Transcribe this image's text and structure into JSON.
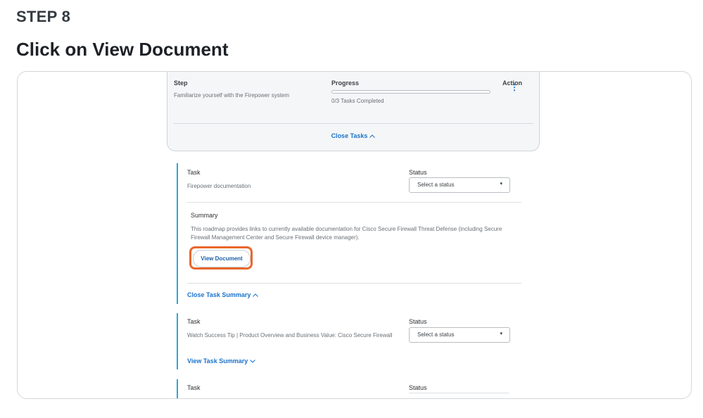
{
  "step_label": "STEP 8",
  "title": "Click on View Document",
  "progress_card": {
    "step_header": "Step",
    "progress_header": "Progress",
    "action_header": "Action",
    "step_text": "Familiarize yourself with the Firepower system",
    "progress_text": "0/3 Tasks Completed",
    "progress_fraction": 0,
    "close_tasks": "Close Tasks"
  },
  "tasks": [
    {
      "task_label": "Task",
      "status_label": "Status",
      "task_name": "Firepower documentation",
      "select_value": "Select a status",
      "summary_label": "Summary",
      "summary_text": "This roadmap provides links to currently available documentation for Cisco Secure Firewall Threat Defense (including Secure Firewall Management Center and Secure Firewall device manager).",
      "view_document": "View Document",
      "close_summary": "Close Task Summary"
    },
    {
      "task_label": "Task",
      "status_label": "Status",
      "task_name": "Watch Success Tip |  Product Overview and Business Value: Cisco Secure Firewall",
      "select_value": "Select a status",
      "view_summary": "View Task Summary"
    },
    {
      "task_label": "Task",
      "status_label": "Status"
    }
  ],
  "colors": {
    "accent_blue": "#1a73c9",
    "task_border": "#28a8e0",
    "highlight": "#e9672c"
  }
}
